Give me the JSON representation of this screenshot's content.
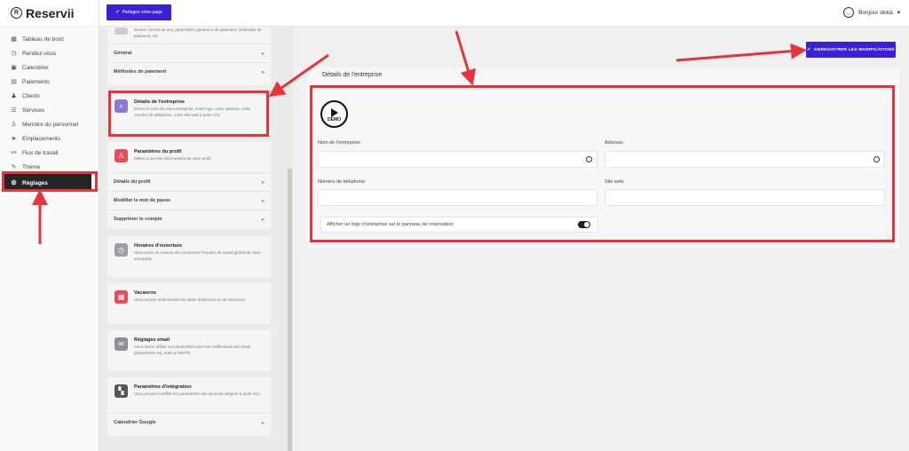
{
  "app": {
    "name": "Reservii",
    "logo_letter": "R"
  },
  "sidebar": {
    "items": [
      {
        "label": "Tableau de bord",
        "icon": "dashboard-icon",
        "glyph": "▦"
      },
      {
        "label": "Rendez-vous",
        "icon": "clock-icon",
        "glyph": "◷"
      },
      {
        "label": "Calendrier",
        "icon": "calendar-icon",
        "glyph": "▣"
      },
      {
        "label": "Paiements",
        "icon": "wallet-icon",
        "glyph": "▤"
      },
      {
        "label": "Clients",
        "icon": "users-icon",
        "glyph": "♟"
      },
      {
        "label": "Services",
        "icon": "list-icon",
        "glyph": "☰"
      },
      {
        "label": "Membre du personnel",
        "icon": "staff-icon",
        "glyph": "♙"
      },
      {
        "label": "Emplacements",
        "icon": "location-icon",
        "glyph": "➤"
      },
      {
        "label": "Flux de travail",
        "icon": "workflow-icon",
        "glyph": "⚯"
      },
      {
        "label": "Thème",
        "icon": "brush-icon",
        "glyph": "✎"
      },
      {
        "label": "Réglages",
        "icon": "gear-icon",
        "glyph": "⚙",
        "active": true
      }
    ]
  },
  "topbar": {
    "share_label": "Partagez votre page",
    "user_greeting": "Bonjour deba"
  },
  "settings": {
    "top_desc": "Devise, format de prix, paramètres généraux de paiement, méthodes de paiement, etc",
    "general_label": "Général",
    "payment_methods_label": "Méthodes de paiement",
    "company_title": "Détails de l'entreprise",
    "company_desc": "Entrez le nom de votre entreprise, votre logo, votre adresse, votre numéro de téléphone, votre site web à partir d'ici",
    "profile_title": "Paramètres du profil",
    "profile_desc": "Mettre à jour les informations de votre profil",
    "profile_details_label": "Détails du profil",
    "change_password_label": "Modifier le mot de passe",
    "delete_account_label": "Supprimer le compte",
    "hours_title": "Horaires d'ouverture",
    "hours_desc": "Vous serez en mesure de coordonner l'horaire de travail global de votre entreprise",
    "holidays_title": "Vacances",
    "holidays_desc": "Vous pouvez sélectionner les dates d'absence ou de vacances",
    "email_title": "Réglages email",
    "email_desc": "Vous devez définir ces paramètres pour les notifications par email (paramètres wp_mail ou SMTP)",
    "integration_title": "Paramètres d'intégration",
    "integration_desc": "Vous pouvez modifier les paramètres des services intégrés à partir d'ici.",
    "google_calendar_label": "Calendrier Google"
  },
  "main": {
    "save_label": "ENREGISTRER LES MODIFICATIONS",
    "card_title": "Détails de l'entreprise",
    "demo_label": "DEMO",
    "company_name_label": "Nom de l'entreprise:",
    "company_name_value": "",
    "address_label": "Adresse:",
    "address_value": "",
    "phone_label": "Numéro de téléphone:",
    "phone_value": "",
    "website_label": "Site web:",
    "website_value": "",
    "logo_toggle_label": "Afficher un logo d'entreprise sur le panneau de réservation",
    "logo_toggle_on": true
  },
  "colors": {
    "accent": "#3a20d6",
    "annotation": "#e8333a",
    "active_nav": "#252525"
  }
}
